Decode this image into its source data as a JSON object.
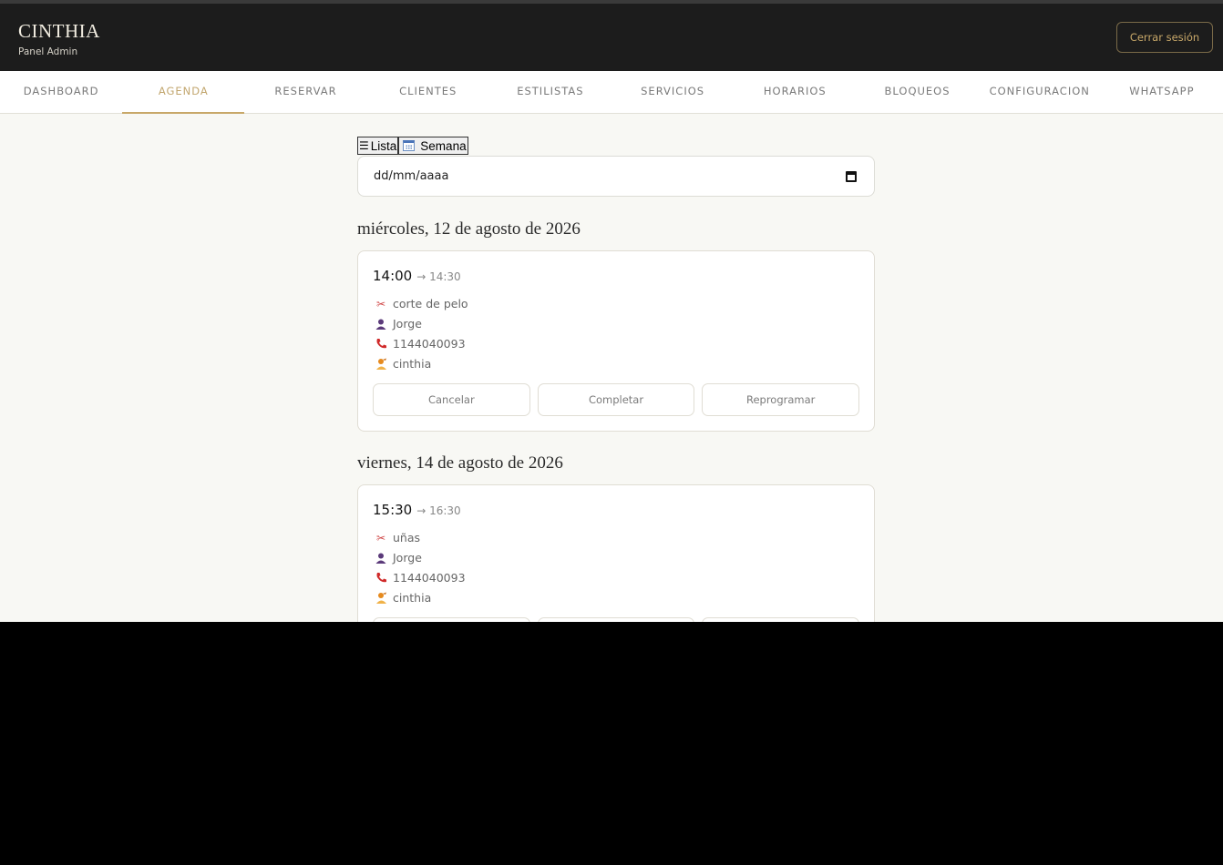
{
  "header": {
    "brand_name": "CINTHIA",
    "brand_sub": "Panel Admin",
    "logout_label": "Cerrar sesión"
  },
  "nav": {
    "items": [
      "DASHBOARD",
      "AGENDA",
      "RESERVAR",
      "CLIENTES",
      "ESTILISTAS",
      "SERVICIOS",
      "HORARIOS",
      "BLOQUEOS",
      "CONFIGURACION",
      "WHATSAPP"
    ],
    "active": "AGENDA"
  },
  "view_toggle": {
    "list_icon": "☰",
    "list_label": "Lista",
    "week_label": "Semana"
  },
  "date_filter": {
    "value": "dd/mm/aaaa"
  },
  "days": [
    {
      "title": "miércoles, 12 de agosto de 2026",
      "appointment": {
        "start": "14:00",
        "end": "→ 14:30",
        "service": "corte de pelo",
        "client": "Jorge",
        "phone": "1144040093",
        "stylist": "cinthia"
      }
    },
    {
      "title": "viernes, 14 de agosto de 2026",
      "appointment": {
        "start": "15:30",
        "end": "→ 16:30",
        "service": "uñas",
        "client": "Jorge",
        "phone": "1144040093",
        "stylist": "cinthia"
      }
    }
  ],
  "actions": {
    "cancel": "Cancelar",
    "complete": "Completar",
    "reschedule": "Reprogramar"
  },
  "icons": {
    "service": "scissors-icon",
    "client": "user-icon",
    "phone": "phone-icon",
    "stylist": "stylist-icon"
  },
  "colors": {
    "header_bg": "#1c1c1c",
    "accent": "#c8a869",
    "page_bg": "#f8f8f4"
  }
}
